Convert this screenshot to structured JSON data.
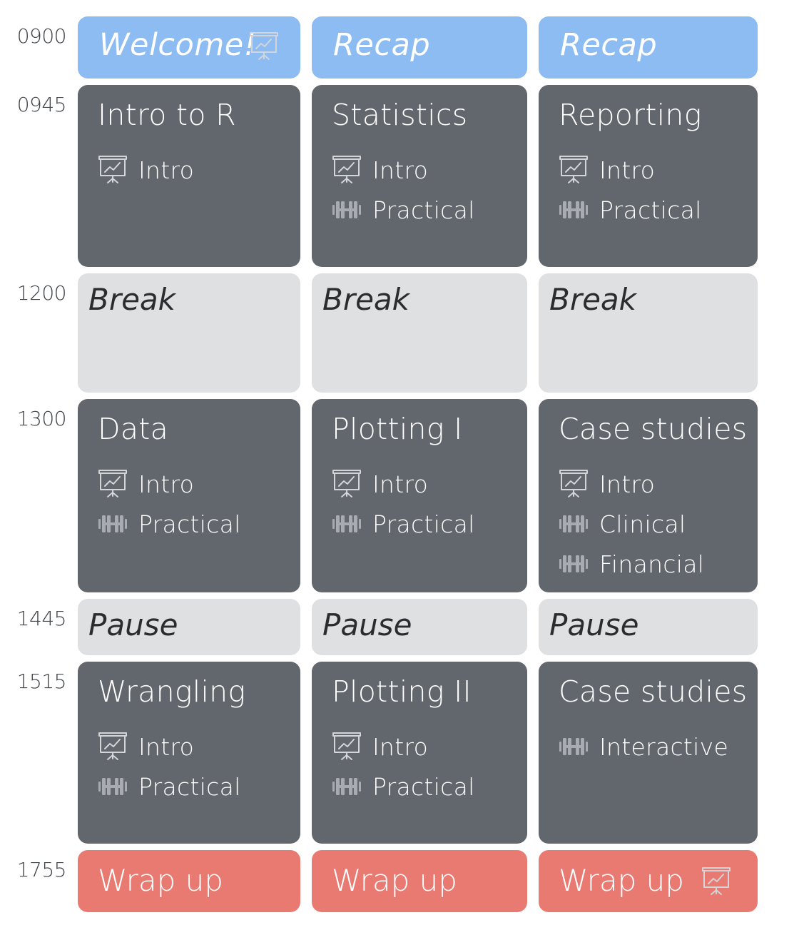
{
  "times": [
    "0900",
    "0945",
    "1200",
    "1300",
    "1445",
    "1515",
    "1755"
  ],
  "days": [
    {
      "welcome": "Welcome!",
      "morning": {
        "title": "Intro to R",
        "items": [
          {
            "icon": "presentation-icon",
            "label": "Intro"
          }
        ]
      },
      "break": "Break",
      "afternoon": {
        "title": "Data",
        "items": [
          {
            "icon": "presentation-icon",
            "label": "Intro"
          },
          {
            "icon": "dumbbell-icon",
            "label": "Practical"
          }
        ]
      },
      "pause": "Pause",
      "late": {
        "title": "Wrangling",
        "items": [
          {
            "icon": "presentation-icon",
            "label": "Intro"
          },
          {
            "icon": "dumbbell-icon",
            "label": "Practical"
          }
        ]
      },
      "wrap": "Wrap up"
    },
    {
      "welcome": "Recap",
      "morning": {
        "title": "Statistics",
        "items": [
          {
            "icon": "presentation-icon",
            "label": "Intro"
          },
          {
            "icon": "dumbbell-icon",
            "label": "Practical"
          }
        ]
      },
      "break": "Break",
      "afternoon": {
        "title": "Plotting I",
        "items": [
          {
            "icon": "presentation-icon",
            "label": "Intro"
          },
          {
            "icon": "dumbbell-icon",
            "label": "Practical"
          }
        ]
      },
      "pause": "Pause",
      "late": {
        "title": "Plotting II",
        "items": [
          {
            "icon": "presentation-icon",
            "label": "Intro"
          },
          {
            "icon": "dumbbell-icon",
            "label": "Practical"
          }
        ]
      },
      "wrap": "Wrap up"
    },
    {
      "welcome": "Recap",
      "morning": {
        "title": "Reporting",
        "items": [
          {
            "icon": "presentation-icon",
            "label": "Intro"
          },
          {
            "icon": "dumbbell-icon",
            "label": "Practical"
          }
        ]
      },
      "break": "Break",
      "afternoon": {
        "title": "Case studies",
        "items": [
          {
            "icon": "presentation-icon",
            "label": "Intro"
          },
          {
            "icon": "dumbbell-icon",
            "label": "Clinical"
          },
          {
            "icon": "dumbbell-icon",
            "label": "Financial"
          }
        ]
      },
      "pause": "Pause",
      "late": {
        "title": "Case studies",
        "items": [
          {
            "icon": "dumbbell-icon",
            "label": "Interactive"
          }
        ]
      },
      "wrap": "Wrap up"
    }
  ],
  "colors": {
    "welcome": "#8dbcf2",
    "session": "#62666d",
    "break": "#dfe0e2",
    "wrap": "#e97a72"
  }
}
